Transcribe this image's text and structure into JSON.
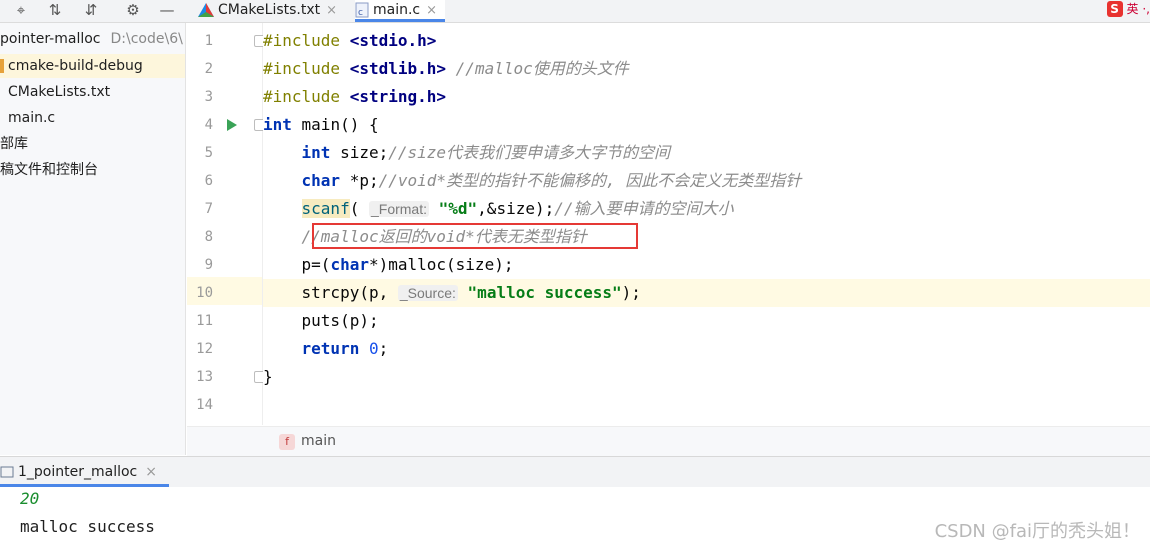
{
  "toolbar": {
    "icons": [
      "crosshair-icon",
      "expand-all-icon",
      "collapse-all-icon",
      "gear-icon",
      "minimize-icon"
    ]
  },
  "tabs": [
    {
      "label": "CMakeLists.txt",
      "icon": "cmake-icon"
    },
    {
      "label": "main.c",
      "icon": "c-file-icon",
      "active": true
    }
  ],
  "ime": {
    "text": "英 ·, "
  },
  "project": {
    "root": {
      "label": "pointer-malloc",
      "path": "D:\\code\\6\\"
    },
    "items": [
      {
        "label": "cmake-build-debug",
        "kind": "folder",
        "selected": true
      },
      {
        "label": "CMakeLists.txt",
        "kind": "cmake"
      },
      {
        "label": "main.c",
        "kind": "c-file"
      },
      {
        "label": "部库",
        "kind": "library"
      },
      {
        "label": "稿文件和控制台",
        "kind": "scratch"
      }
    ]
  },
  "editor": {
    "line_numbers": [
      "1",
      "2",
      "3",
      "4",
      "5",
      "6",
      "7",
      "8",
      "9",
      "10",
      "11",
      "12",
      "13",
      "14"
    ],
    "current_line": 10,
    "lines": {
      "l1": {
        "directive": "#include",
        "header": "<stdio.h>"
      },
      "l2": {
        "directive": "#include",
        "header": "<stdlib.h>",
        "comment": "//malloc使用的头文件"
      },
      "l3": {
        "directive": "#include",
        "header": "<string.h>"
      },
      "l4": {
        "kw": "int",
        "rest": " main() {"
      },
      "l5": {
        "kw": "int",
        "rest": " size;",
        "comment": "//size代表我们要申请多大字节的空间"
      },
      "l6": {
        "kw": "char",
        "rest": " *p;",
        "comment": "//void*类型的指针不能偏移的, 因此不会定义无类型指针"
      },
      "l7": {
        "fn": "scanf",
        "open": "(",
        "hint": "_Format:",
        "str": "\"%d\"",
        "rest": ",&size);",
        "comment": "//输入要申请的空间大小"
      },
      "l8": {
        "comment": "//malloc返回的void*代表无类型指针"
      },
      "l9": {
        "pre": "p=(",
        "kw": "char",
        "rest": "*)malloc(size);"
      },
      "l10": {
        "pre": "strcpy(p, ",
        "hint": "_Source:",
        "str": "\"malloc success\"",
        "rest": ");"
      },
      "l11": {
        "text": "puts(p);"
      },
      "l12": {
        "kw": "return",
        "num": "0",
        "rest": ";"
      },
      "l13": {
        "text": "}"
      }
    }
  },
  "breadcrumb": {
    "badge": "f",
    "label": "main"
  },
  "run": {
    "tab_label": "1_pointer_malloc",
    "console": {
      "input": "20",
      "output": "malloc success"
    }
  },
  "watermark": "CSDN @fai厅的秃头姐！"
}
